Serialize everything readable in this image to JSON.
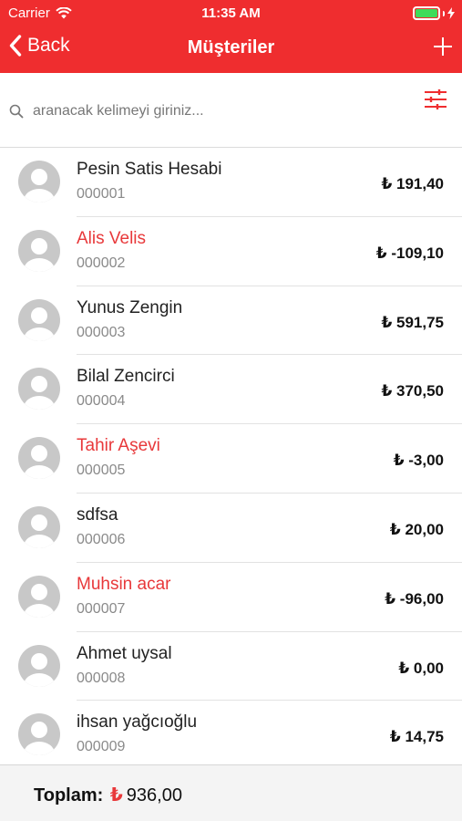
{
  "status_bar": {
    "carrier": "Carrier",
    "time": "11:35 AM",
    "battery_level": 1.0
  },
  "nav": {
    "back_label": "Back",
    "title": "Müşteriler"
  },
  "search": {
    "placeholder": "aranacak kelimeyi giriniz...",
    "value": ""
  },
  "icons": {
    "back": "chevron-left-icon",
    "add": "plus-icon",
    "search": "search-icon",
    "filter": "sliders-icon",
    "avatar": "user-avatar-icon",
    "wifi": "wifi-icon",
    "battery": "battery-icon"
  },
  "colors": {
    "brand": "#ef2d2f",
    "negative_name": "#e8383a",
    "code_text": "#8a8a8a"
  },
  "customers": [
    {
      "name": "Pesin Satis Hesabi",
      "code": "000001",
      "balance": "₺ 191,40",
      "negative": false
    },
    {
      "name": "Alis Velis",
      "code": "000002",
      "balance": "₺ -109,10",
      "negative": true
    },
    {
      "name": "Yunus Zengin",
      "code": "000003",
      "balance": "₺ 591,75",
      "negative": false
    },
    {
      "name": "Bilal Zencirci",
      "code": "000004",
      "balance": "₺ 370,50",
      "negative": false
    },
    {
      "name": "Tahir Aşevi",
      "code": "000005",
      "balance": "₺ -3,00",
      "negative": true
    },
    {
      "name": "sdfsa",
      "code": "000006",
      "balance": "₺ 20,00",
      "negative": false
    },
    {
      "name": "Muhsin acar",
      "code": "000007",
      "balance": "₺ -96,00",
      "negative": true
    },
    {
      "name": "Ahmet uysal",
      "code": "000008",
      "balance": "₺ 0,00",
      "negative": false
    },
    {
      "name": "ihsan yağcıoğlu",
      "code": "000009",
      "balance": "₺ 14,75",
      "negative": false
    }
  ],
  "footer": {
    "total_label": "Toplam:",
    "currency": "₺",
    "total_amount": "936,00"
  }
}
